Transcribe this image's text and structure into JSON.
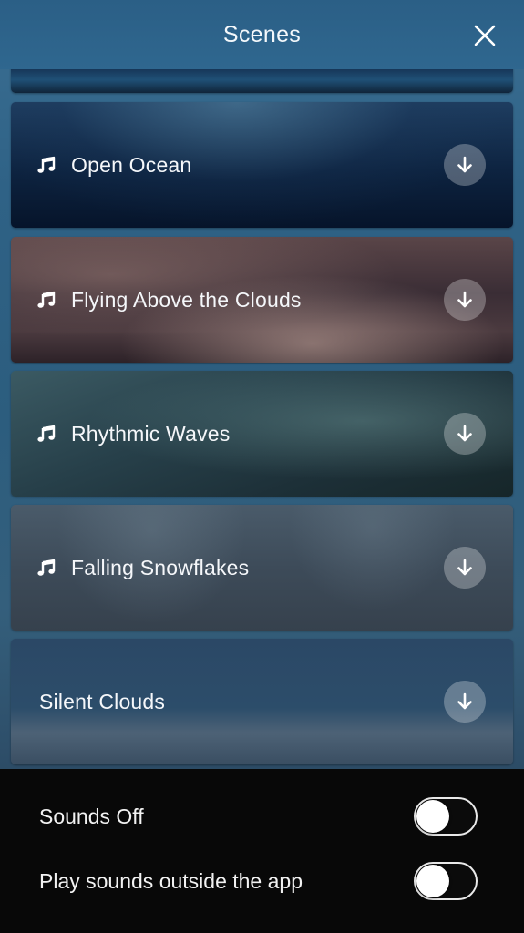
{
  "header": {
    "title": "Scenes",
    "close_icon": "close-icon"
  },
  "scenes": [
    {
      "label": "Open Ocean",
      "icon": "music-note-icon",
      "action_icon": "download-arrow-icon"
    },
    {
      "label": "Flying Above the Clouds",
      "icon": "music-note-icon",
      "action_icon": "download-arrow-icon"
    },
    {
      "label": "Rhythmic Waves",
      "icon": "music-note-icon",
      "action_icon": "download-arrow-icon"
    },
    {
      "label": "Falling Snowflakes",
      "icon": "music-note-icon",
      "action_icon": "download-arrow-icon"
    },
    {
      "label": "Silent Clouds",
      "icon": null,
      "action_icon": "download-arrow-icon"
    }
  ],
  "settings": [
    {
      "label": "Sounds Off",
      "enabled": false
    },
    {
      "label": "Play sounds outside the app",
      "enabled": false
    }
  ],
  "colors": {
    "header_bg": "#2f678f",
    "bottom_bar_bg": "#080808",
    "text": "#ffffff",
    "toggle_border": "#e9e9e9"
  }
}
